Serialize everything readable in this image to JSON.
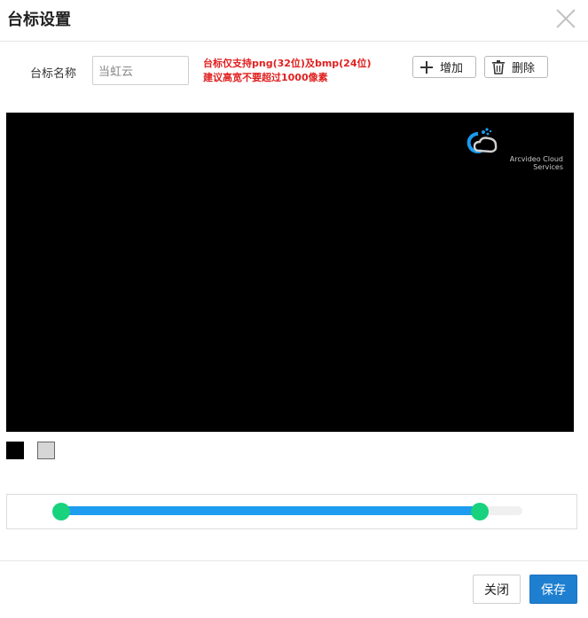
{
  "dialog": {
    "title": "台标设置"
  },
  "form": {
    "name_label": "台标名称",
    "name_value": "当虹云",
    "hint_line1": "台标仅支持png(32位)及bmp(24位)",
    "hint_line2": "建议高宽不要超过1000像素",
    "add_label": "增加",
    "delete_label": "删除"
  },
  "preview": {
    "logo_line1": "Arcvideo Cloud",
    "logo_line2": "Services",
    "background_color": "#000000"
  },
  "colors": {
    "swatch_black": "#000000",
    "swatch_gray": "#d6d6d6",
    "slider_fill": "#1e9df0",
    "slider_handle": "#18d27e",
    "save_button": "#1e7fd0",
    "hint_text": "#e02020"
  },
  "icons": {
    "close": "close-icon",
    "add": "plus-icon",
    "delete": "trash-icon",
    "logo": "cloud-logo-icon"
  },
  "footer": {
    "close_label": "关闭",
    "save_label": "保存"
  }
}
